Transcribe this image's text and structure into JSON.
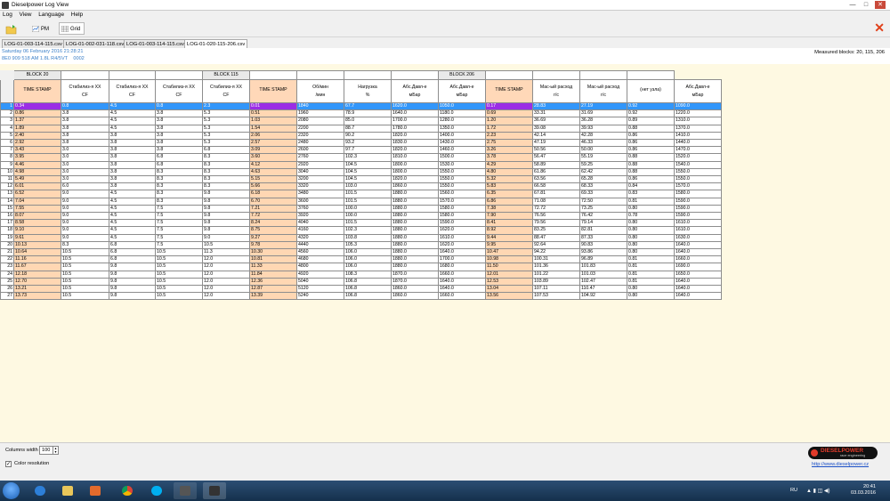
{
  "window": {
    "title": "Dieselpower Log View",
    "controls": {
      "minimize": "—",
      "maximize": "□",
      "close": "✕"
    }
  },
  "menu": [
    "Log",
    "View",
    "Language",
    "Help"
  ],
  "toolbar": {
    "pm_label": "PM",
    "grid_label": "Grid"
  },
  "file_tabs": [
    "LOG-01-003-114-115.csv",
    "LOG-01-002-031-118.csv",
    "LOG-01-003-114-115.csv",
    "LOG-01-020-115-206.csv"
  ],
  "file_info": {
    "date": "Saturday 06 February 2016 21:28:21",
    "vehicle": "8E0 909 518 AM   1.8L R4/5VT",
    "code": "0002",
    "measured_blocks": "Measured blocks: 20, 115, 206"
  },
  "blocks": {
    "b20": "BLOCK 20",
    "b115": "BLOCK 115",
    "b206": "BLOCK 206"
  },
  "headers": [
    {
      "top": "TIME STAMP",
      "bot": ""
    },
    {
      "top": "Стабилиз-я ХХ",
      "bot": "CF"
    },
    {
      "top": "Стабилиз-я ХХ",
      "bot": "CF"
    },
    {
      "top": "Стабилиз-я ХХ",
      "bot": "CF"
    },
    {
      "top": "Стабилиз-я ХХ",
      "bot": "CF"
    },
    {
      "top": "TIME STAMP",
      "bot": ""
    },
    {
      "top": "Об/мин",
      "bot": "/мин"
    },
    {
      "top": "Нагрузка",
      "bot": "%"
    },
    {
      "top": "Абс.Давл-е",
      "bot": "мБар"
    },
    {
      "top": "Абс.Давл-е",
      "bot": "мБар"
    },
    {
      "top": "TIME STAMP",
      "bot": ""
    },
    {
      "top": "Мас-ый расход",
      "bot": "г/с"
    },
    {
      "top": "Мас-ый расход",
      "bot": "г/с"
    },
    {
      "top": "(нет узла)",
      "bot": ""
    },
    {
      "top": "Абс.Давл-е",
      "bot": "мБар"
    }
  ],
  "rows": [
    [
      "0.34",
      "0.8",
      "4.5",
      "0.8",
      "2.3",
      "0.01",
      "1840",
      "67.7",
      "1620.0",
      "1050.0",
      "0.17",
      "28.83",
      "27.19",
      "0.92",
      "1090.0"
    ],
    [
      "0.86",
      "3.8",
      "4.5",
      "3.8",
      "5.3",
      "0.51",
      "1960",
      "78.9",
      "1640.0",
      "1180.0",
      "0.69",
      "33.31",
      "31.69",
      "0.92",
      "1220.0"
    ],
    [
      "1.37",
      "3.8",
      "4.5",
      "3.8",
      "5.3",
      "1.03",
      "2080",
      "85.0",
      "1700.0",
      "1280.0",
      "1.20",
      "36.69",
      "36.28",
      "0.89",
      "1310.0"
    ],
    [
      "1.89",
      "3.8",
      "4.5",
      "3.8",
      "5.3",
      "1.54",
      "2200",
      "88.7",
      "1780.0",
      "1350.0",
      "1.72",
      "39.08",
      "39.93",
      "0.88",
      "1370.0"
    ],
    [
      "2.40",
      "3.8",
      "3.8",
      "3.8",
      "5.3",
      "2.06",
      "2320",
      "90.2",
      "1820.0",
      "1400.0",
      "2.23",
      "42.14",
      "42.28",
      "0.86",
      "1410.0"
    ],
    [
      "2.92",
      "3.8",
      "3.8",
      "3.8",
      "5.3",
      "2.57",
      "2480",
      "93.2",
      "1830.0",
      "1430.0",
      "2.75",
      "47.19",
      "46.33",
      "0.86",
      "1440.0"
    ],
    [
      "3.43",
      "3.0",
      "3.8",
      "3.8",
      "6.8",
      "3.09",
      "2600",
      "97.7",
      "1820.0",
      "1460.0",
      "3.26",
      "50.56",
      "50.00",
      "0.86",
      "1470.0"
    ],
    [
      "3.95",
      "3.0",
      "3.8",
      "6.8",
      "8.3",
      "3.60",
      "2760",
      "102.3",
      "1810.0",
      "1500.0",
      "3.78",
      "56.47",
      "55.19",
      "0.88",
      "1520.0"
    ],
    [
      "4.46",
      "3.0",
      "3.8",
      "6.8",
      "8.3",
      "4.12",
      "2920",
      "104.5",
      "1800.0",
      "1530.0",
      "4.29",
      "58.89",
      "59.25",
      "0.88",
      "1540.0"
    ],
    [
      "4.98",
      "3.0",
      "3.8",
      "8.3",
      "8.3",
      "4.63",
      "3040",
      "104.5",
      "1800.0",
      "1550.0",
      "4.80",
      "61.86",
      "62.42",
      "0.88",
      "1550.0"
    ],
    [
      "5.49",
      "3.0",
      "3.8",
      "8.3",
      "8.3",
      "5.15",
      "3200",
      "104.5",
      "1820.0",
      "1550.0",
      "5.32",
      "63.56",
      "65.28",
      "0.86",
      "1550.0"
    ],
    [
      "6.01",
      "6.0",
      "3.8",
      "8.3",
      "8.3",
      "5.66",
      "3320",
      "103.0",
      "1860.0",
      "1550.0",
      "5.83",
      "66.58",
      "68.33",
      "0.84",
      "1570.0"
    ],
    [
      "6.52",
      "9.0",
      "4.5",
      "8.3",
      "9.8",
      "6.18",
      "3480",
      "101.5",
      "1880.0",
      "1560.0",
      "6.35",
      "67.81",
      "69.33",
      "0.83",
      "1580.0"
    ],
    [
      "7.04",
      "9.0",
      "4.5",
      "8.3",
      "9.8",
      "6.70",
      "3600",
      "101.5",
      "1880.0",
      "1570.0",
      "6.86",
      "71.08",
      "72.50",
      "0.81",
      "1590.0"
    ],
    [
      "7.55",
      "9.0",
      "4.5",
      "7.5",
      "9.8",
      "7.21",
      "3760",
      "100.0",
      "1880.0",
      "1580.0",
      "7.38",
      "72.72",
      "73.25",
      "0.80",
      "1590.0"
    ],
    [
      "8.07",
      "9.0",
      "4.5",
      "7.5",
      "9.8",
      "7.72",
      "3920",
      "100.0",
      "1880.0",
      "1580.0",
      "7.90",
      "76.56",
      "76.42",
      "0.78",
      "1590.0"
    ],
    [
      "8.58",
      "9.0",
      "4.5",
      "7.5",
      "9.8",
      "8.24",
      "4040",
      "101.5",
      "1880.0",
      "1590.0",
      "8.41",
      "79.56",
      "79.14",
      "0.80",
      "1610.0"
    ],
    [
      "9.10",
      "9.0",
      "4.5",
      "7.5",
      "9.8",
      "8.75",
      "4160",
      "102.3",
      "1880.0",
      "1620.0",
      "8.92",
      "83.25",
      "82.81",
      "0.80",
      "1610.0"
    ],
    [
      "9.61",
      "9.0",
      "4.5",
      "7.5",
      "9.0",
      "9.27",
      "4320",
      "103.8",
      "1880.0",
      "1610.0",
      "9.44",
      "88.47",
      "87.33",
      "0.80",
      "1630.0"
    ],
    [
      "10.13",
      "8.3",
      "6.8",
      "7.5",
      "10.5",
      "9.78",
      "4440",
      "105.3",
      "1880.0",
      "1620.0",
      "9.95",
      "92.64",
      "90.83",
      "0.80",
      "1640.0"
    ],
    [
      "10.64",
      "10.5",
      "6.8",
      "10.5",
      "11.3",
      "10.30",
      "4560",
      "106.0",
      "1880.0",
      "1640.0",
      "10.47",
      "94.22",
      "93.86",
      "0.80",
      "1640.0"
    ],
    [
      "11.16",
      "10.5",
      "6.8",
      "10.5",
      "12.0",
      "10.81",
      "4680",
      "106.0",
      "1880.0",
      "1700.0",
      "10.98",
      "100.31",
      "96.89",
      "0.81",
      "1660.0"
    ],
    [
      "11.67",
      "10.5",
      "9.8",
      "10.5",
      "12.0",
      "11.33",
      "4800",
      "106.0",
      "1880.0",
      "1680.0",
      "11.50",
      "101.36",
      "101.83",
      "0.81",
      "1690.0"
    ],
    [
      "12.18",
      "10.5",
      "9.8",
      "10.5",
      "12.0",
      "11.84",
      "4920",
      "108.3",
      "1870.0",
      "1660.0",
      "12.01",
      "101.22",
      "101.03",
      "0.81",
      "1650.0"
    ],
    [
      "12.70",
      "10.5",
      "9.8",
      "10.5",
      "12.0",
      "12.36",
      "5040",
      "106.8",
      "1870.0",
      "1640.0",
      "12.53",
      "103.89",
      "102.47",
      "0.81",
      "1640.0"
    ],
    [
      "13.21",
      "10.5",
      "9.8",
      "10.5",
      "12.0",
      "12.87",
      "5120",
      "106.8",
      "1860.0",
      "1640.0",
      "13.04",
      "107.11",
      "110.47",
      "0.80",
      "1640.0"
    ],
    [
      "13.73",
      "10.5",
      "9.8",
      "10.5",
      "12.0",
      "13.39",
      "5240",
      "106.8",
      "1860.0",
      "1660.0",
      "13.56",
      "107.53",
      "104.92",
      "0.80",
      "1640.0"
    ]
  ],
  "bottom": {
    "columns_width_label": "Columns width",
    "columns_width_value": "100",
    "color_resolution_label": "Color resolution",
    "logo_name": "DIESELPOWER",
    "logo_sub": "race engineering",
    "url": "http://www.dieselpower.cz"
  },
  "tray": {
    "lang": "RU",
    "time": "20:41",
    "date": "03.03.2016"
  }
}
